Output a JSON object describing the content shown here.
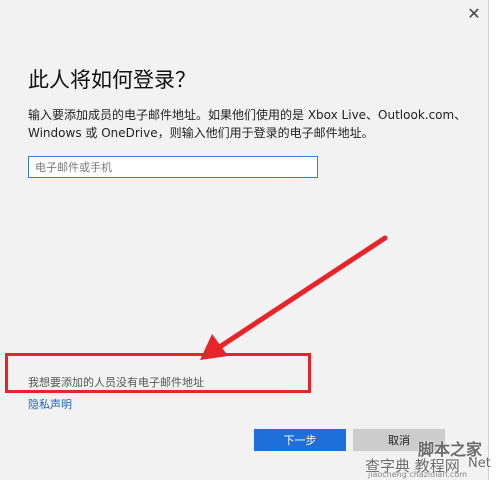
{
  "window": {
    "close_glyph": "✕"
  },
  "dialog": {
    "title": "此人将如何登录？",
    "description": "输入要添加成员的电子邮件地址。如果他们使用的是 Xbox Live、Outlook.com、Windows 或 OneDrive，则输入他们用于登录的电子邮件地址。",
    "email_input": {
      "value": "",
      "placeholder": "电子邮件或手机"
    },
    "no_email_link": "我想要添加的人员没有电子邮件地址",
    "privacy_link": "隐私声明",
    "next_button": "下一步",
    "cancel_button": "取消"
  },
  "annotations": {
    "highlight_color": "#e8242a",
    "arrow_color": "#e8242a"
  },
  "watermark": {
    "logo_text": "脚本之家",
    "brand": "查字典 教程网",
    "net": "Net",
    "url": "jiaocheng.chazidian.com"
  },
  "colors": {
    "accent": "#1e6fd9",
    "link": "#1565c0",
    "dialog_bg": "#f2f2f2"
  }
}
